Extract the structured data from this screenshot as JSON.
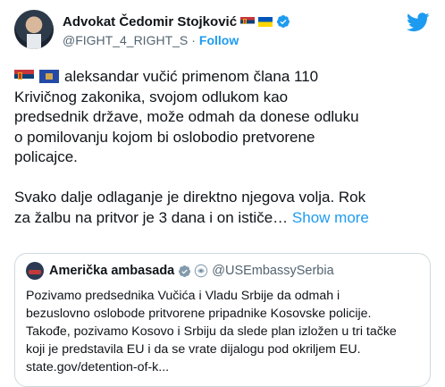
{
  "author": {
    "name": "Advokat Čedomir Stojković",
    "handle": "@FIGHT_4_RIGHT_S",
    "separator": "·",
    "follow_label": "Follow",
    "flags": [
      "serbia-flag-icon",
      "ukraine-flag-icon"
    ],
    "verified": true
  },
  "tweet": {
    "lines": [
      "aleksandar vučić primenom člana 110",
      "Krivičnog zakonika, svojom odlukom  kao",
      "predsednik države, može odmah da donese odluku",
      "o pomilovanju kojom bi oslobodio pretvorene",
      "policajce.",
      "Svako dalje odlaganje je direktno njegova volja. Rok",
      "za žalbu na pritvor je 3 dana i on ističe…"
    ],
    "show_more_label": "Show more",
    "leading_flags": [
      "serbia-flag-icon",
      "kosovo-flag-icon"
    ]
  },
  "quoted": {
    "name": "Američka ambasada",
    "handle": "@USEmbassySerbia",
    "lines": [
      "Pozivamo predsednika Vučića i Vladu Srbije da odmah i",
      "bezuslovno oslobode pritvorene pripadnike Kosovske policije.",
      "Takođe, pozivamo Kosovo i Srbiju da slede plan izložen u tri tačke",
      "koji je predstavila EU i da se vrate dijalogu pod okriljem EU.",
      "state.gov/detention-of-k..."
    ]
  },
  "colors": {
    "link": "#1d9bf0",
    "text": "#0f1419",
    "muted": "#536471",
    "border": "#cfd9de",
    "verified_gray": "#829aab"
  }
}
